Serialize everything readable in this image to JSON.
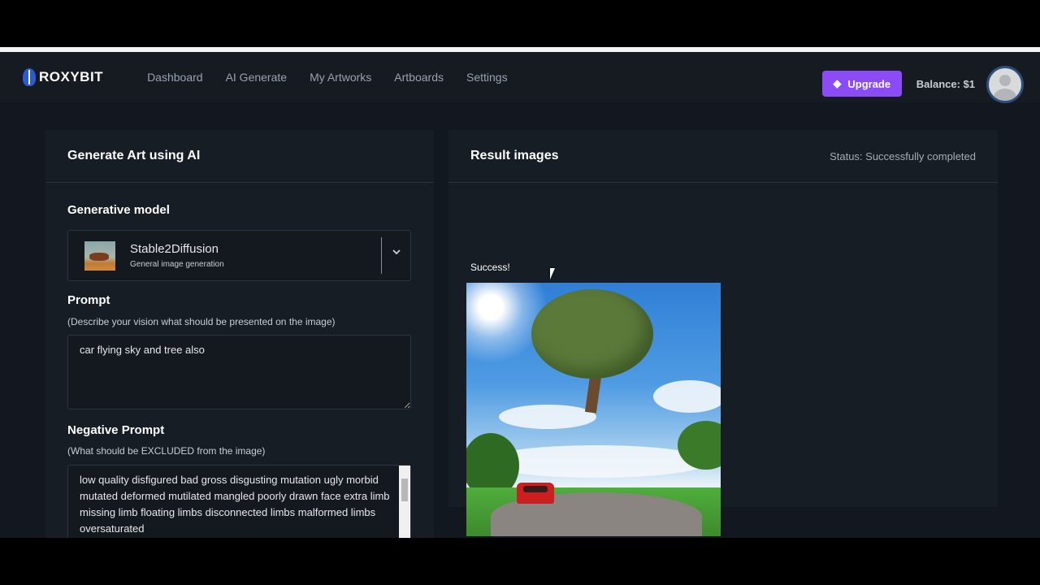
{
  "nav": {
    "brand": "ROXYBIT",
    "links": [
      "Dashboard",
      "AI Generate",
      "My Artworks",
      "Artboards",
      "Settings"
    ],
    "upgrade_label": "Upgrade",
    "balance": "Balance: $1"
  },
  "generate": {
    "title": "Generate Art using AI",
    "model_label": "Generative model",
    "model_name": "Stable2Diffusion",
    "model_desc": "General image generation",
    "prompt_label": "Prompt",
    "prompt_hint": "(Describe your vision what should be presented on the image)",
    "prompt_value": "car flying sky and tree also",
    "neg_label": "Negative Prompt",
    "neg_hint": "(What should be EXCLUDED from the image)",
    "neg_value": "low quality disfigured bad gross disgusting mutation ugly morbid mutated deformed mutilated mangled poorly drawn face extra limb missing limb floating limbs disconnected limbs malformed limbs oversaturated"
  },
  "result": {
    "title": "Result images",
    "status": "Status: Successfully completed",
    "message": "Success!"
  },
  "colors": {
    "accent": "#8b4cf7",
    "background": "#131820",
    "card": "#171d25"
  }
}
